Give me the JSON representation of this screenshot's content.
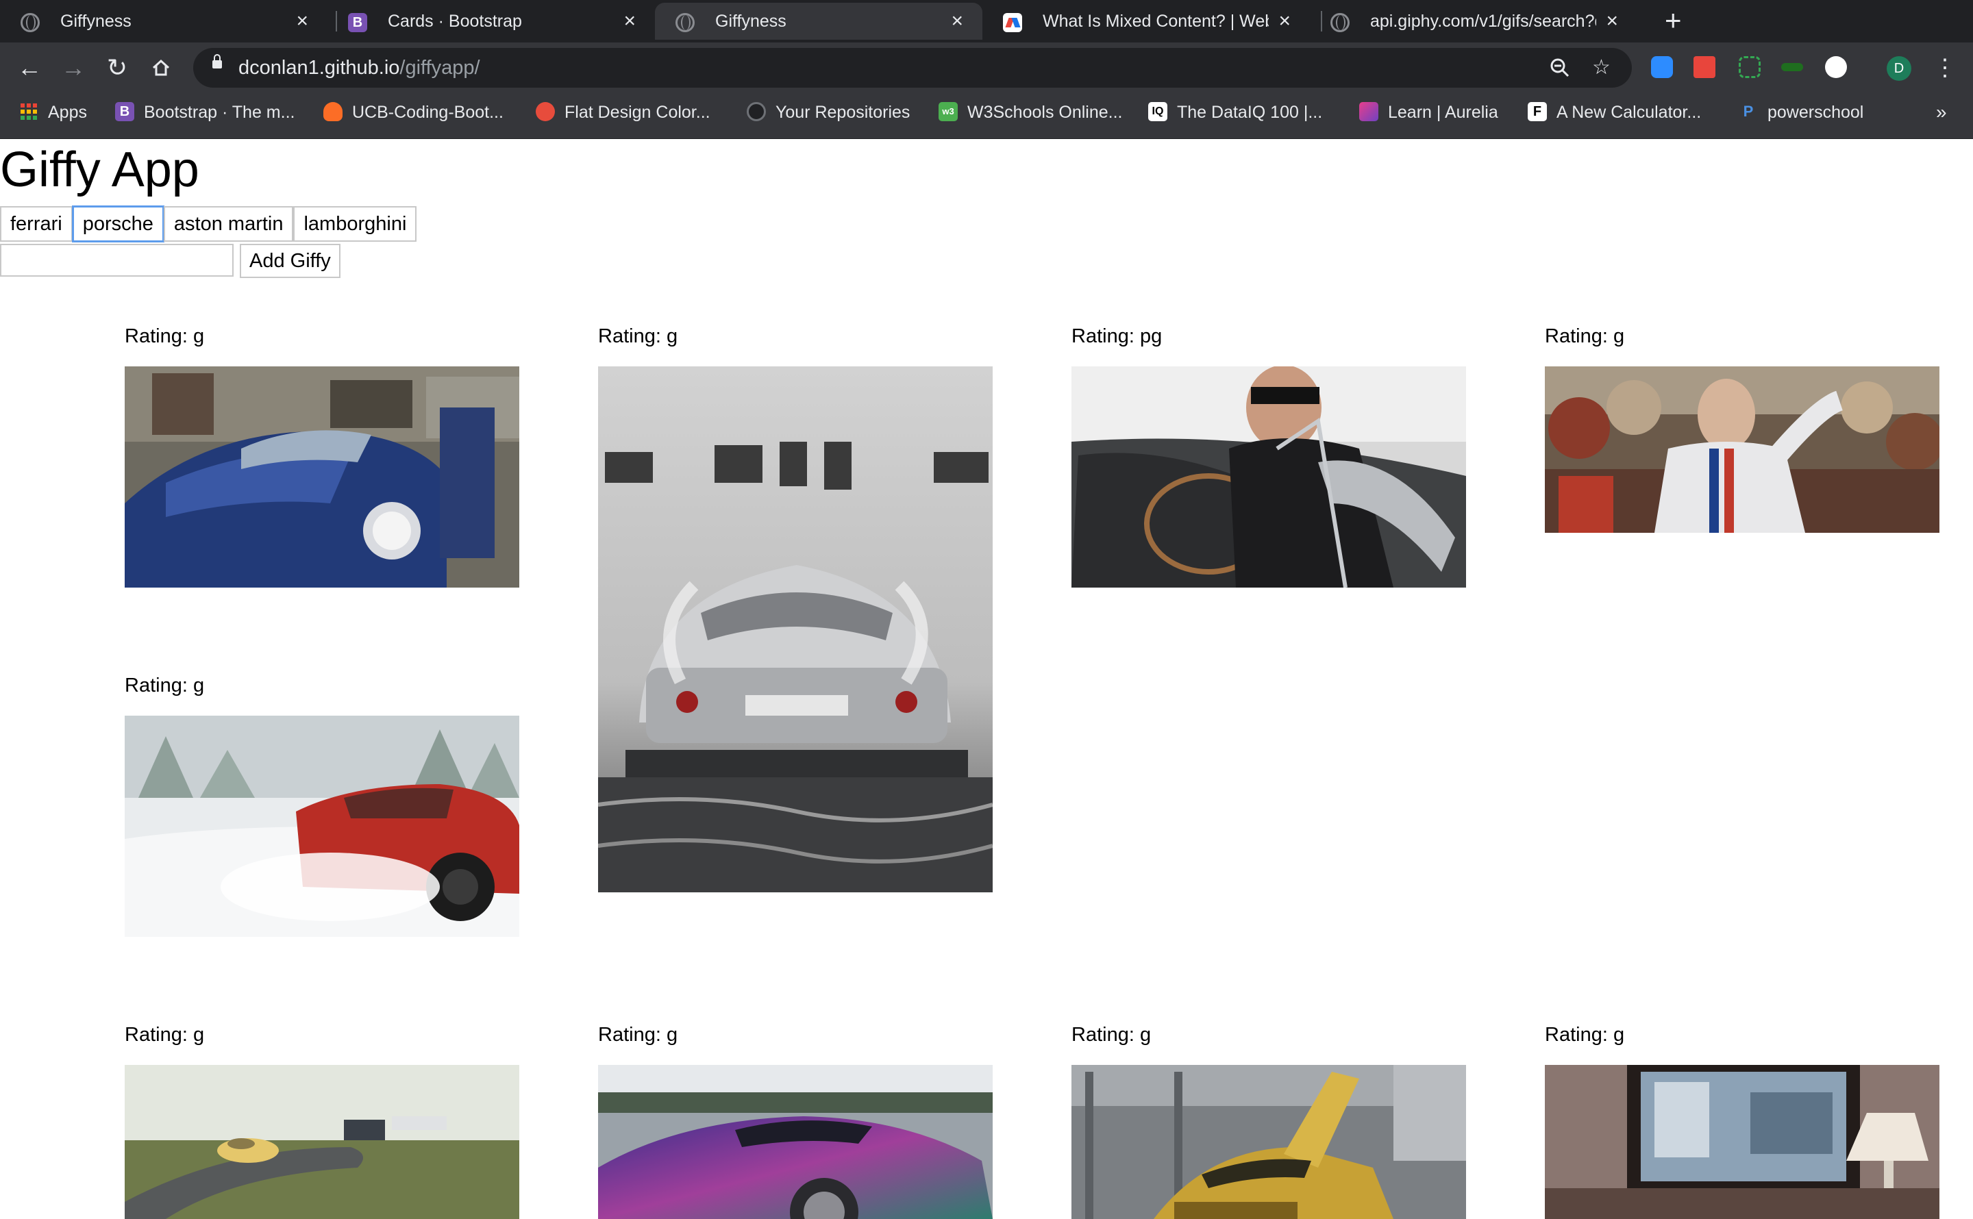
{
  "browser": {
    "tabs": [
      {
        "title": "Giffyness",
        "icon": "globe-icon",
        "active": false
      },
      {
        "title": "Cards · Bootstrap",
        "icon": "bootstrap-icon",
        "active": false
      },
      {
        "title": "Giffyness",
        "icon": "globe-icon",
        "active": true
      },
      {
        "title": "What Is Mixed Content? | Web",
        "icon": "web-dev-icon",
        "active": false
      },
      {
        "title": "api.giphy.com/v1/gifs/search?q",
        "icon": "globe-icon",
        "active": false
      }
    ],
    "close_glyph": "×",
    "new_tab_glyph": "+",
    "url_host": "dconlan1.github.io",
    "url_path": "/giffyapp/",
    "profile_initial": "D",
    "bookmarks": [
      {
        "label": "Apps",
        "icon": "apps-grid-icon"
      },
      {
        "label": "Bootstrap · The m...",
        "icon": "bootstrap-icon"
      },
      {
        "label": "UCB-Coding-Boot...",
        "icon": "gitlab-icon"
      },
      {
        "label": "Flat Design Color...",
        "icon": "flat-design-icon"
      },
      {
        "label": "Your Repositories",
        "icon": "github-icon"
      },
      {
        "label": "W3Schools Online...",
        "icon": "w3schools-icon"
      },
      {
        "label": "The DataIQ 100 |...",
        "icon": "dataiq-icon"
      },
      {
        "label": "Learn | Aurelia",
        "icon": "aurelia-icon"
      },
      {
        "label": "A New Calculator...",
        "icon": "f-icon"
      },
      {
        "label": "powerschool",
        "icon": "powerschool-icon"
      }
    ],
    "bookmarks_more": "»"
  },
  "app": {
    "title": "Giffy App",
    "topics": [
      "ferrari",
      "porsche",
      "aston martin",
      "lamborghini"
    ],
    "focused_topic": "porsche",
    "search_value": "",
    "add_button_label": "Add Giffy"
  },
  "gifs": [
    {
      "rating": "Rating: g",
      "subject": "blue porsche with open door in street"
    },
    {
      "rating": "Rating: g",
      "subject": "silver porsche rear over water reflection"
    },
    {
      "rating": "Rating: pg",
      "subject": "man in sunglasses driving convertible"
    },
    {
      "rating": "Rating: g",
      "subject": "racing driver waving to crowd"
    },
    {
      "rating": "Rating: g",
      "subject": "red porsche drifting in snow"
    },
    {
      "rating": "Rating: g",
      "subject": "yellow porsche on country road"
    },
    {
      "rating": "Rating: g",
      "subject": "purple chrome porsche 911"
    },
    {
      "rating": "Rating: g",
      "subject": "gold lamborghini with scissor doors in garage"
    },
    {
      "rating": "Rating: g",
      "subject": "framed picture on wall with lamp"
    }
  ]
}
